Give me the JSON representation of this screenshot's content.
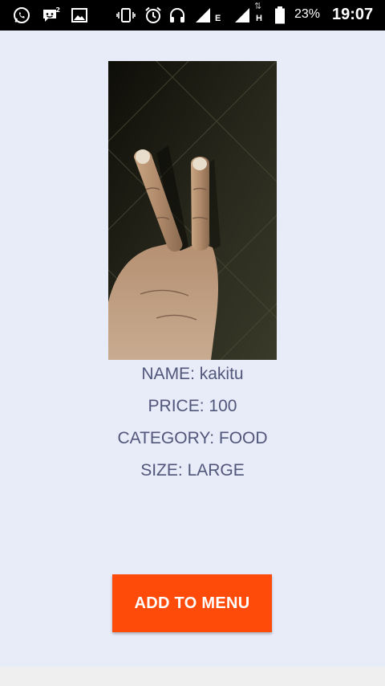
{
  "status_bar": {
    "icons": [
      "whatsapp-icon",
      "messenger-notification-icon",
      "gallery-icon",
      "vibrate-icon",
      "alarm-icon",
      "headset-icon",
      "signal-icon",
      "network-type-icon",
      "signal-icon",
      "network-type-icon",
      "battery-icon"
    ],
    "network_type_1": "E",
    "network_type_2": "H",
    "battery": "23%",
    "time": "19:07"
  },
  "product": {
    "image_name": "product-photo",
    "name_line": "NAME: kakitu",
    "price_line": "PRICE: 100",
    "category_line": "CATEGORY: FOOD",
    "size_line": "SIZE: LARGE"
  },
  "actions": {
    "add_label": "ADD TO MENU"
  },
  "colors": {
    "background": "#e8ebf8",
    "detail_text": "#50577a",
    "button": "#ff4b0a",
    "status_bar": "#000000"
  }
}
